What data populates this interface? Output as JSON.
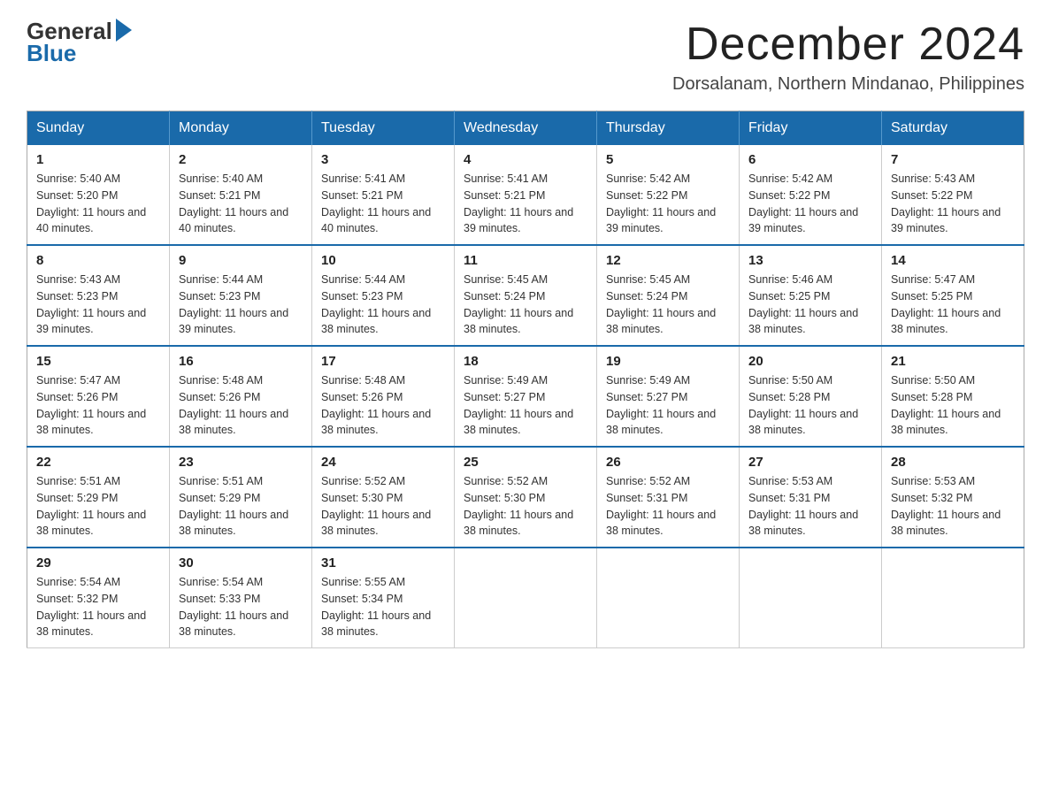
{
  "logo": {
    "general": "General",
    "blue": "Blue"
  },
  "title": "December 2024",
  "subtitle": "Dorsalanam, Northern Mindanao, Philippines",
  "calendar": {
    "headers": [
      "Sunday",
      "Monday",
      "Tuesday",
      "Wednesday",
      "Thursday",
      "Friday",
      "Saturday"
    ],
    "weeks": [
      [
        {
          "day": "1",
          "sunrise": "5:40 AM",
          "sunset": "5:20 PM",
          "daylight": "11 hours and 40 minutes."
        },
        {
          "day": "2",
          "sunrise": "5:40 AM",
          "sunset": "5:21 PM",
          "daylight": "11 hours and 40 minutes."
        },
        {
          "day": "3",
          "sunrise": "5:41 AM",
          "sunset": "5:21 PM",
          "daylight": "11 hours and 40 minutes."
        },
        {
          "day": "4",
          "sunrise": "5:41 AM",
          "sunset": "5:21 PM",
          "daylight": "11 hours and 39 minutes."
        },
        {
          "day": "5",
          "sunrise": "5:42 AM",
          "sunset": "5:22 PM",
          "daylight": "11 hours and 39 minutes."
        },
        {
          "day": "6",
          "sunrise": "5:42 AM",
          "sunset": "5:22 PM",
          "daylight": "11 hours and 39 minutes."
        },
        {
          "day": "7",
          "sunrise": "5:43 AM",
          "sunset": "5:22 PM",
          "daylight": "11 hours and 39 minutes."
        }
      ],
      [
        {
          "day": "8",
          "sunrise": "5:43 AM",
          "sunset": "5:23 PM",
          "daylight": "11 hours and 39 minutes."
        },
        {
          "day": "9",
          "sunrise": "5:44 AM",
          "sunset": "5:23 PM",
          "daylight": "11 hours and 39 minutes."
        },
        {
          "day": "10",
          "sunrise": "5:44 AM",
          "sunset": "5:23 PM",
          "daylight": "11 hours and 38 minutes."
        },
        {
          "day": "11",
          "sunrise": "5:45 AM",
          "sunset": "5:24 PM",
          "daylight": "11 hours and 38 minutes."
        },
        {
          "day": "12",
          "sunrise": "5:45 AM",
          "sunset": "5:24 PM",
          "daylight": "11 hours and 38 minutes."
        },
        {
          "day": "13",
          "sunrise": "5:46 AM",
          "sunset": "5:25 PM",
          "daylight": "11 hours and 38 minutes."
        },
        {
          "day": "14",
          "sunrise": "5:47 AM",
          "sunset": "5:25 PM",
          "daylight": "11 hours and 38 minutes."
        }
      ],
      [
        {
          "day": "15",
          "sunrise": "5:47 AM",
          "sunset": "5:26 PM",
          "daylight": "11 hours and 38 minutes."
        },
        {
          "day": "16",
          "sunrise": "5:48 AM",
          "sunset": "5:26 PM",
          "daylight": "11 hours and 38 minutes."
        },
        {
          "day": "17",
          "sunrise": "5:48 AM",
          "sunset": "5:26 PM",
          "daylight": "11 hours and 38 minutes."
        },
        {
          "day": "18",
          "sunrise": "5:49 AM",
          "sunset": "5:27 PM",
          "daylight": "11 hours and 38 minutes."
        },
        {
          "day": "19",
          "sunrise": "5:49 AM",
          "sunset": "5:27 PM",
          "daylight": "11 hours and 38 minutes."
        },
        {
          "day": "20",
          "sunrise": "5:50 AM",
          "sunset": "5:28 PM",
          "daylight": "11 hours and 38 minutes."
        },
        {
          "day": "21",
          "sunrise": "5:50 AM",
          "sunset": "5:28 PM",
          "daylight": "11 hours and 38 minutes."
        }
      ],
      [
        {
          "day": "22",
          "sunrise": "5:51 AM",
          "sunset": "5:29 PM",
          "daylight": "11 hours and 38 minutes."
        },
        {
          "day": "23",
          "sunrise": "5:51 AM",
          "sunset": "5:29 PM",
          "daylight": "11 hours and 38 minutes."
        },
        {
          "day": "24",
          "sunrise": "5:52 AM",
          "sunset": "5:30 PM",
          "daylight": "11 hours and 38 minutes."
        },
        {
          "day": "25",
          "sunrise": "5:52 AM",
          "sunset": "5:30 PM",
          "daylight": "11 hours and 38 minutes."
        },
        {
          "day": "26",
          "sunrise": "5:52 AM",
          "sunset": "5:31 PM",
          "daylight": "11 hours and 38 minutes."
        },
        {
          "day": "27",
          "sunrise": "5:53 AM",
          "sunset": "5:31 PM",
          "daylight": "11 hours and 38 minutes."
        },
        {
          "day": "28",
          "sunrise": "5:53 AM",
          "sunset": "5:32 PM",
          "daylight": "11 hours and 38 minutes."
        }
      ],
      [
        {
          "day": "29",
          "sunrise": "5:54 AM",
          "sunset": "5:32 PM",
          "daylight": "11 hours and 38 minutes."
        },
        {
          "day": "30",
          "sunrise": "5:54 AM",
          "sunset": "5:33 PM",
          "daylight": "11 hours and 38 minutes."
        },
        {
          "day": "31",
          "sunrise": "5:55 AM",
          "sunset": "5:34 PM",
          "daylight": "11 hours and 38 minutes."
        },
        null,
        null,
        null,
        null
      ]
    ]
  }
}
